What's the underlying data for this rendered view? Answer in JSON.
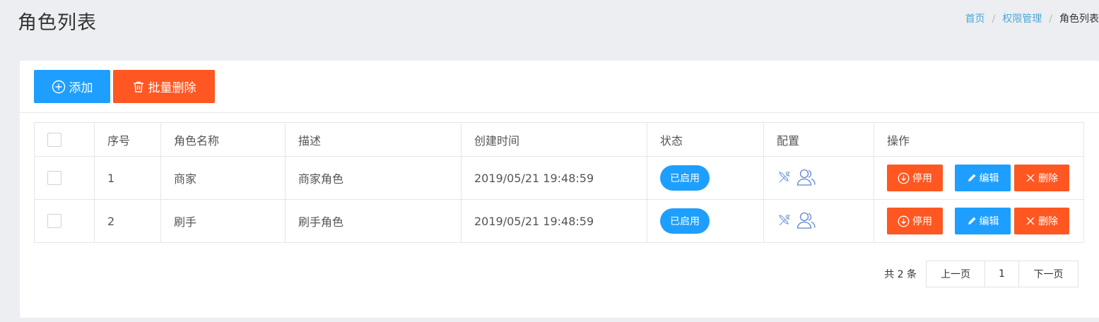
{
  "page": {
    "title": "角色列表"
  },
  "breadcrumb": {
    "home": "首页",
    "parent": "权限管理",
    "current": "角色列表",
    "separator": "/"
  },
  "toolbar": {
    "add_label": "添加",
    "batch_delete_label": "批量删除"
  },
  "table": {
    "headers": [
      "序号",
      "角色名称",
      "描述",
      "创建时间",
      "状态",
      "配置",
      "操作"
    ],
    "rows": [
      {
        "index": "1",
        "name": "商家",
        "description": "商家角色",
        "created": "2019/05/21 19:48:59",
        "status": "已启用"
      },
      {
        "index": "2",
        "name": "刷手",
        "description": "刷手角色",
        "created": "2019/05/21 19:48:59",
        "status": "已启用"
      }
    ],
    "actions": {
      "disable": "停用",
      "edit": "编辑",
      "delete": "删除"
    },
    "config_icons": [
      "tools-icon",
      "user-icon"
    ]
  },
  "pagination": {
    "total_text": "共 2 条",
    "prev": "上一页",
    "current_page": "1",
    "next": "下一页"
  },
  "colors": {
    "primary": "#1e9fff",
    "danger": "#ff5722",
    "background": "#eceef2",
    "link": "#4aa8d8"
  }
}
